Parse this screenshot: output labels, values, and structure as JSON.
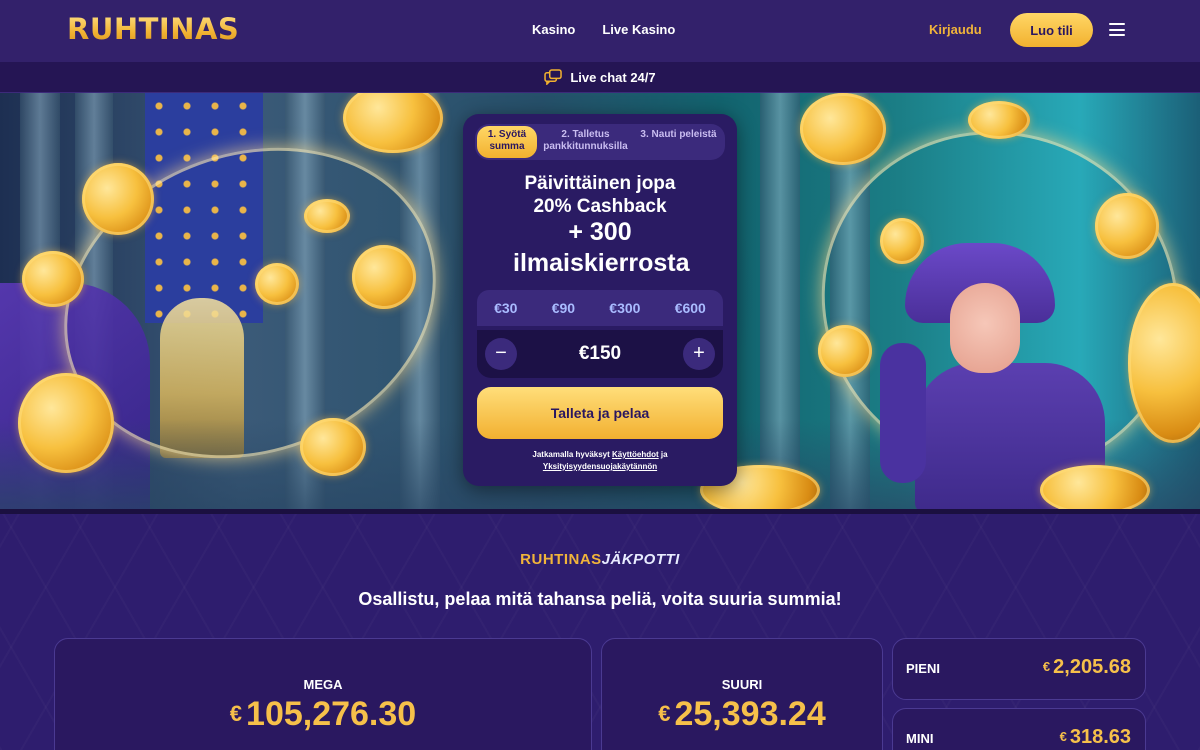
{
  "header": {
    "logo": "RUHTINAS",
    "nav": [
      "Kasino",
      "Live Kasino"
    ],
    "login": "Kirjaudu",
    "signup": "Luo tili",
    "live_chat": "Live chat 24/7"
  },
  "offer": {
    "steps": [
      {
        "label": "1. Syötä summa",
        "active": true
      },
      {
        "label": "2. Talletus pankkitunnuksilla",
        "active": false
      },
      {
        "label": "3. Nauti peleistä",
        "active": false
      }
    ],
    "headline": "Päivittäinen jopa 20% Cashback",
    "subheadline": "+ 300 ilmaiskierrosta",
    "amount_options": [
      "€30",
      "€90",
      "€300",
      "€600"
    ],
    "amount_value": "€150",
    "minus": "−",
    "plus": "+",
    "cta": "Talleta ja pelaa",
    "terms_prefix": "Jatkamalla hyväksyt",
    "terms_link": "Käyttöehdot",
    "terms_and": "ja",
    "privacy_link": "Yksityisyydensuojakäytännön"
  },
  "jackpot": {
    "logo_left": "RUHTINAS",
    "logo_right": "JÄKPOTTI",
    "tagline": "Osallistu, pelaa mitä tahansa peliä, voita suuria summia!",
    "currency": "€",
    "tiers": [
      {
        "name": "MEGA",
        "amount": "105,276.30"
      },
      {
        "name": "SUURI",
        "amount": "25,393.24"
      },
      {
        "name": "PIENI",
        "amount": "2,205.68"
      },
      {
        "name": "MINI",
        "amount": "318.63"
      }
    ]
  },
  "colors": {
    "gold": "#f2b12f",
    "navy": "#2a1b63",
    "header": "#33216b"
  }
}
